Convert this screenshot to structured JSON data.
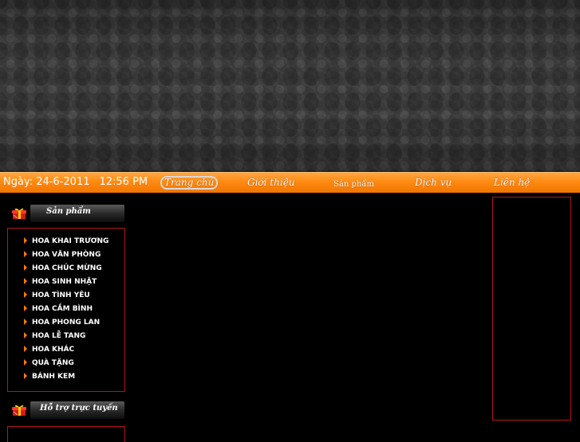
{
  "header": {
    "date_label": "Ngày: 24-6-2011",
    "time_label": "12:56 PM"
  },
  "nav": {
    "home": "Trang chủ",
    "about": "Giới thiệu",
    "products": "Sản phẩm",
    "services": "Dịch vụ",
    "contact": "Liên hệ"
  },
  "sidebar": {
    "products_title": "Sản phẩm",
    "support_title": "Hỗ trợ trực tuyến",
    "items": [
      "HOA KHAI TRƯƠNG",
      "HOA VĂN PHÒNG",
      "HOA CHÚC MỪNG",
      "HOA SINH NHẬT",
      "HOA TÌNH YÊU",
      "HOA CẮM BÌNH",
      "HOA PHONG LAN",
      "HOA LỄ TANG",
      "HOA KHÁC",
      "QUÀ TẶNG",
      "BÁNH KEM"
    ]
  },
  "icons": {
    "section": "gift-icon",
    "menu_bullet": "arrow-right-icon"
  },
  "colors": {
    "accent": "#ff8a12",
    "border": "#b51616",
    "background": "#000000"
  }
}
